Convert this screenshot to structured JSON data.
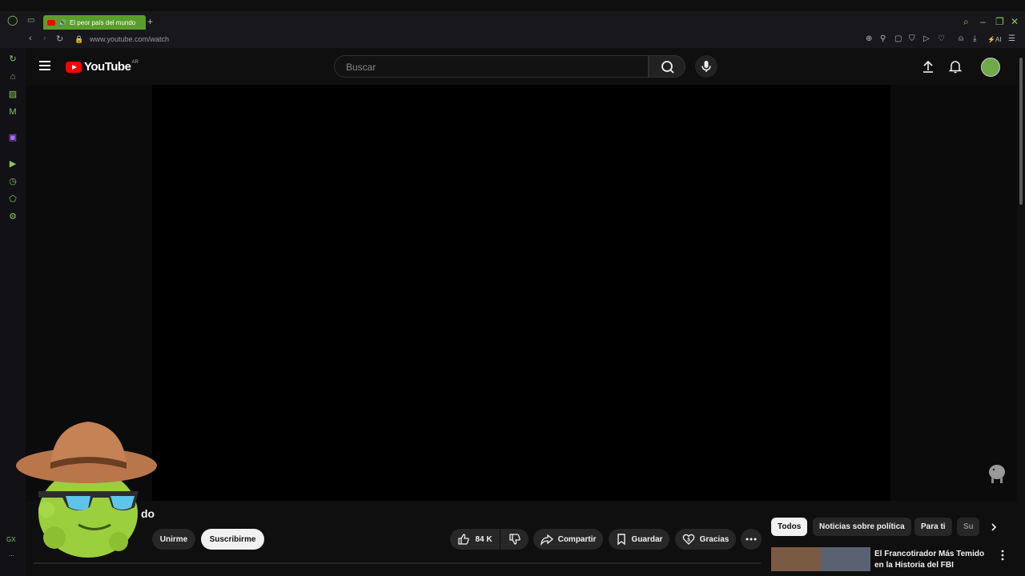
{
  "browser": {
    "tab_title": "El peor país del mundo",
    "url": "www.youtube.com/watch",
    "accent": "#5a9e2a",
    "ai_label": "AI",
    "gx_label": "GX",
    "more_label": "..."
  },
  "youtube": {
    "logo_text": "YouTube",
    "region": "AR",
    "search_placeholder": "Buscar"
  },
  "video": {
    "title_fragment": "do",
    "join_label": "Unirme",
    "subscribe_label": "Suscribirme",
    "likes": "84 K",
    "share_label": "Compartir",
    "save_label": "Guardar",
    "thanks_label": "Gracias"
  },
  "chips": [
    "Todos",
    "Noticias sobre política",
    "Para ti",
    "Su"
  ],
  "recommendation": {
    "title": "El Francotirador Más Temido en la Historia del FBI"
  }
}
